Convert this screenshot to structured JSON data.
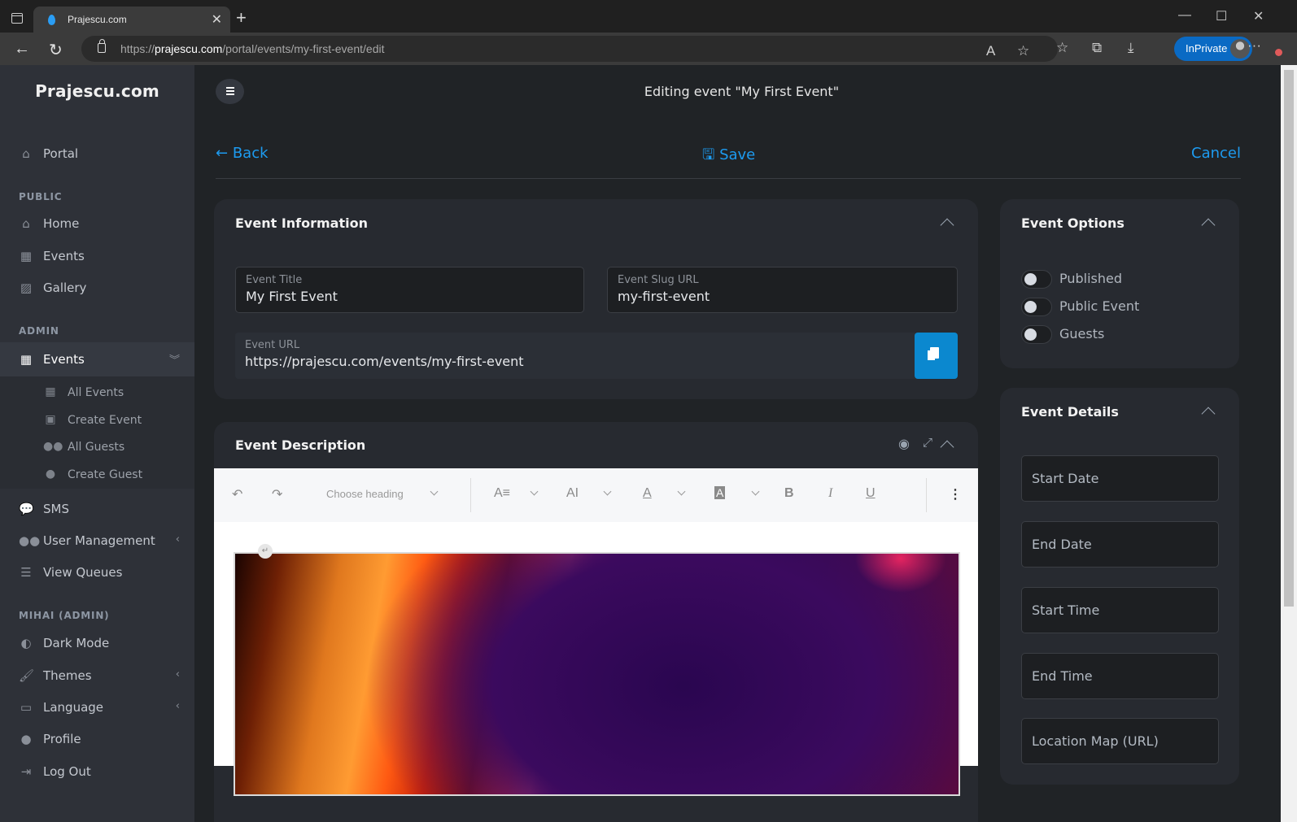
{
  "browser": {
    "tab_title": "Prajescu.com",
    "url_scheme": "https://",
    "url_domain": "prajescu.com",
    "url_path": "/portal/events/my-first-event/edit",
    "inprivate_label": "InPrivate"
  },
  "sidebar": {
    "brand": "Prajescu.com",
    "portal": {
      "label": "Portal",
      "icon": "home-user-icon"
    },
    "sections": {
      "public": "PUBLIC",
      "admin": "ADMIN",
      "user": "MIHAI (ADMIN)"
    },
    "public_items": [
      {
        "label": "Home",
        "icon": "home-icon"
      },
      {
        "label": "Events",
        "icon": "calendar-icon"
      },
      {
        "label": "Gallery",
        "icon": "images-icon"
      }
    ],
    "admin_events": {
      "label": "Events",
      "icon": "calendar-icon",
      "expanded": true
    },
    "admin_sub_items": [
      {
        "label": "All Events",
        "icon": "calendar-icon"
      },
      {
        "label": "Create Event",
        "icon": "calendar-plus-icon"
      },
      {
        "label": "All Guests",
        "icon": "users-icon"
      },
      {
        "label": "Create Guest",
        "icon": "user-tie-icon"
      }
    ],
    "admin_items": [
      {
        "label": "SMS",
        "icon": "sms-icon"
      },
      {
        "label": "User Management",
        "icon": "user-group-icon"
      },
      {
        "label": "View Queues",
        "icon": "list-icon"
      }
    ],
    "user_items": [
      {
        "label": "Dark Mode",
        "icon": "contrast-icon"
      },
      {
        "label": "Themes",
        "icon": "brush-icon"
      },
      {
        "label": "Language",
        "icon": "language-icon"
      },
      {
        "label": "Profile",
        "icon": "user-gear-icon"
      },
      {
        "label": "Log Out",
        "icon": "logout-icon"
      }
    ]
  },
  "header": {
    "title": "Editing event \"My First Event\""
  },
  "actions": {
    "back": "Back",
    "save": "Save",
    "cancel": "Cancel"
  },
  "event_information": {
    "title": "Event Information",
    "event_title_label": "Event Title",
    "event_title_value": "My First Event",
    "slug_label": "Event Slug URL",
    "slug_value": "my-first-event",
    "url_label": "Event URL",
    "url_value": "https://prajescu.com/events/my-first-event"
  },
  "event_options": {
    "title": "Event Options",
    "toggles": [
      {
        "label": "Published",
        "checked": false
      },
      {
        "label": "Public Event",
        "checked": false
      },
      {
        "label": "Guests",
        "checked": false
      }
    ]
  },
  "event_details": {
    "title": "Event Details",
    "fields": [
      "Start Date",
      "End Date",
      "Start Time",
      "End Time",
      "Location Map (URL)"
    ]
  },
  "event_description": {
    "title": "Event Description",
    "heading_select": "Choose heading",
    "toolbar": {
      "undo": "↶",
      "redo": "↷",
      "font_size": "A≡",
      "font_family": "AI",
      "font_color": "A",
      "bg_color": "A",
      "bold": "B",
      "italic": "I",
      "underline": "U",
      "more": "⋮"
    }
  },
  "colors": {
    "accent": "#1d9bf0",
    "copy_button": "#0b88cf",
    "sidebar_bg": "#2e3138",
    "main_bg": "#202326",
    "card_bg": "#272a30"
  }
}
